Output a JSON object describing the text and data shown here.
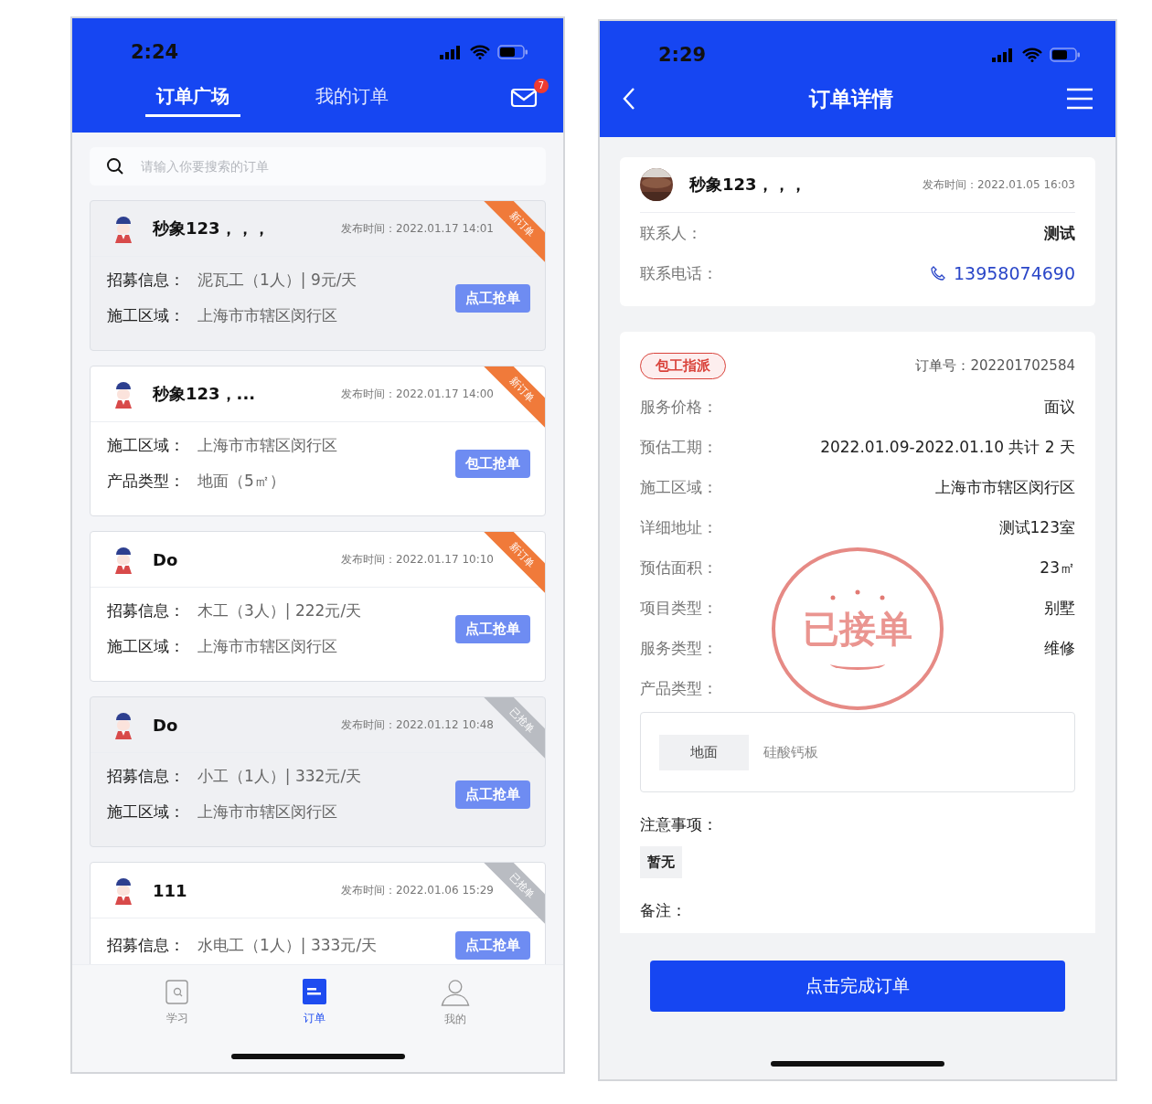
{
  "left_phone": {
    "status_time": "2:24",
    "tabs": [
      {
        "label": "订单广场",
        "selected": true
      },
      {
        "label": "我的订单",
        "selected": false
      }
    ],
    "mail_badge": "7",
    "search": {
      "placeholder": "请输入你要搜索的订单"
    },
    "orders": [
      {
        "name": "秒象123，，，",
        "time": "发布时间：2022.01.17 14:01",
        "highlighted": true,
        "ribbon": {
          "text": "新订单",
          "kind": "new"
        },
        "fields": [
          {
            "label": "招募信息：",
            "value": "泥瓦工（1人）| 9元/天"
          },
          {
            "label": "施工区域：",
            "value": "上海市市辖区闵行区"
          }
        ],
        "button": "点工抢单"
      },
      {
        "name": "秒象123，...",
        "time": "发布时间：2022.01.17 14:00",
        "highlighted": false,
        "ribbon": {
          "text": "新订单",
          "kind": "new"
        },
        "fields": [
          {
            "label": "施工区域：",
            "value": "上海市市辖区闵行区"
          },
          {
            "label": "产品类型：",
            "value": "地面（5㎡）"
          }
        ],
        "button": "包工抢单"
      },
      {
        "name": "Do",
        "time": "发布时间：2022.01.17 10:10",
        "highlighted": false,
        "ribbon": {
          "text": "新订单",
          "kind": "new"
        },
        "fields": [
          {
            "label": "招募信息：",
            "value": "木工（3人）| 222元/天"
          },
          {
            "label": "施工区域：",
            "value": "上海市市辖区闵行区"
          }
        ],
        "button": "点工抢单"
      },
      {
        "name": "Do",
        "time": "发布时间：2022.01.12 10:48",
        "highlighted": true,
        "ribbon": {
          "text": "已抢单",
          "kind": "taken"
        },
        "fields": [
          {
            "label": "招募信息：",
            "value": "小工（1人）| 332元/天"
          },
          {
            "label": "施工区域：",
            "value": "上海市市辖区闵行区"
          }
        ],
        "button": "点工抢单"
      },
      {
        "name": "111",
        "time": "发布时间：2022.01.06 15:29",
        "highlighted": false,
        "ribbon": {
          "text": "已抢单",
          "kind": "taken"
        },
        "fields": [
          {
            "label": "招募信息：",
            "value": "水电工（1人）| 333元/天"
          }
        ],
        "button": "点工抢单"
      }
    ],
    "tab_bar": [
      {
        "label": "学习",
        "kind": "study",
        "selected": false
      },
      {
        "label": "订单",
        "kind": "orders",
        "selected": true
      },
      {
        "label": "我的",
        "kind": "me",
        "selected": false
      }
    ]
  },
  "right_phone": {
    "status_time": "2:29",
    "title": "订单详情",
    "owner": {
      "name": "秒象123，，，",
      "time": "发布时间：2022.01.05 16:03",
      "contact_label": "联系人：",
      "contact": "测试",
      "phone_label": "联系电话：",
      "phone": "13958074690"
    },
    "order": {
      "tag": "包工指派",
      "number": "订单号：202201702584",
      "fields": [
        {
          "label": "服务价格：",
          "value": "面议"
        },
        {
          "label": "预估工期：",
          "value": "2022.01.09-2022.01.10 共计 2 天"
        },
        {
          "label": "施工区域：",
          "value": "上海市市辖区闵行区"
        },
        {
          "label": "详细地址：",
          "value": "测试123室"
        },
        {
          "label": "预估面积：",
          "value": "23㎡"
        },
        {
          "label": "项目类型：",
          "value": "别墅"
        },
        {
          "label": "服务类型：",
          "value": "维修"
        },
        {
          "label": "产品类型："
        }
      ],
      "product": {
        "chip": "地面",
        "value": "硅酸钙板"
      },
      "notes_label": "注意事项：",
      "notes": "暂无",
      "remark_label": "备注：",
      "stamp": "已接单"
    },
    "complete_button": "点击完成订单"
  }
}
